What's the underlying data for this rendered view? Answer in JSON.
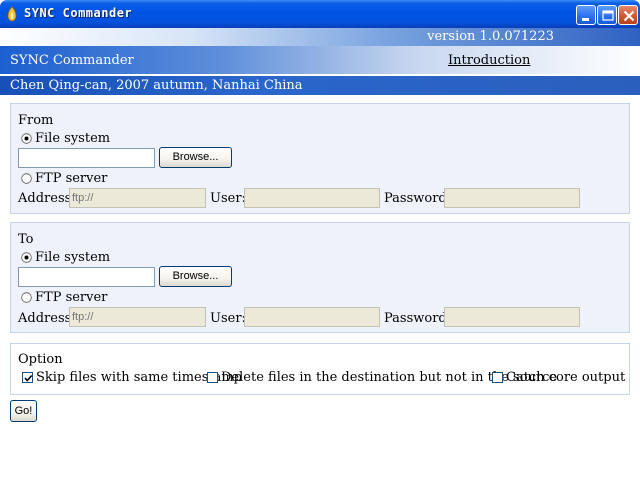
{
  "window": {
    "title": "SYNC Commander",
    "version": "version 1.0.071223"
  },
  "header": {
    "app_name": "SYNC Commander",
    "intro_link": "Introduction",
    "credit": "Chen Qing-can, 2007 autumn, Nanhai China"
  },
  "from": {
    "title": "From",
    "source_type_selected": "File system",
    "file_system_label": "File system",
    "path_value": "",
    "browse_label": "Browse...",
    "ftp_label": "FTP server",
    "address_label": "Address:",
    "address_placeholder": "ftp://",
    "user_label": "User:",
    "password_label": "Password:"
  },
  "to": {
    "title": "To",
    "source_type_selected": "File system",
    "file_system_label": "File system",
    "path_value": "",
    "browse_label": "Browse...",
    "ftp_label": "FTP server",
    "address_label": "Address:",
    "address_placeholder": "ftp://",
    "user_label": "User:",
    "password_label": "Password:"
  },
  "option": {
    "title": "Option",
    "skip_same_timestamp": {
      "label": "Skip files with same timestamp",
      "checked": true
    },
    "delete_extra": {
      "label": "Delete files in the destination but not in the source",
      "checked": false
    },
    "catch_core_output": {
      "label": "Catch core output",
      "checked": false
    }
  },
  "go_label": "Go!"
}
